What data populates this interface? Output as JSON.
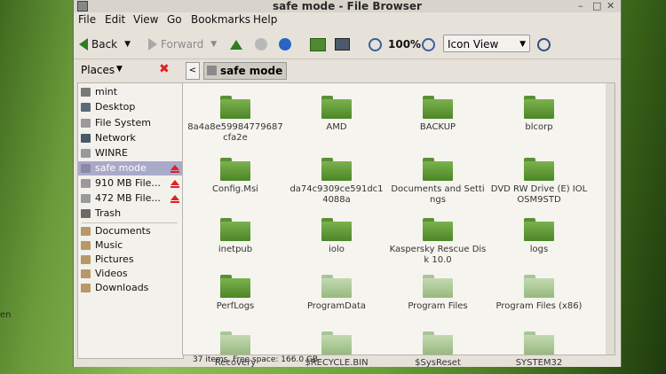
{
  "window": {
    "title": "safe mode - File Browser",
    "controls": [
      "–",
      "□",
      "✕"
    ]
  },
  "menu": [
    "File",
    "Edit",
    "View",
    "Go",
    "Bookmarks",
    "Help"
  ],
  "toolbar": {
    "back": "Back",
    "forward": "Forward",
    "zoom": "100%",
    "view_mode": "Icon View"
  },
  "places": {
    "label": "Places"
  },
  "path": {
    "current": "safe mode"
  },
  "sidebar": {
    "devices": [
      {
        "label": "mint",
        "icon": "drive-icon",
        "selected": false,
        "eject": false
      },
      {
        "label": "Desktop",
        "icon": "desktop-icon",
        "selected": false,
        "eject": false
      },
      {
        "label": "File System",
        "icon": "filesystem-icon",
        "selected": false,
        "eject": false
      },
      {
        "label": "Network",
        "icon": "network-icon",
        "selected": false,
        "eject": false
      },
      {
        "label": "WINRE",
        "icon": "drive-icon",
        "selected": false,
        "eject": false
      },
      {
        "label": "safe mode",
        "icon": "drive-icon",
        "selected": true,
        "eject": true
      },
      {
        "label": "910 MB File...",
        "icon": "drive-icon",
        "selected": false,
        "eject": true
      },
      {
        "label": "472 MB File...",
        "icon": "drive-icon",
        "selected": false,
        "eject": true
      },
      {
        "label": "Trash",
        "icon": "trash-icon",
        "selected": false,
        "eject": false
      }
    ],
    "bookmarks": [
      {
        "label": "Documents",
        "icon": "folder-icon"
      },
      {
        "label": "Music",
        "icon": "folder-icon"
      },
      {
        "label": "Pictures",
        "icon": "folder-icon"
      },
      {
        "label": "Videos",
        "icon": "folder-icon"
      },
      {
        "label": "Downloads",
        "icon": "folder-icon"
      }
    ]
  },
  "files": [
    {
      "name": "8a4a8e59984779687cfa2e",
      "style": "normal"
    },
    {
      "name": "AMD",
      "style": "normal"
    },
    {
      "name": "BACKUP",
      "style": "normal"
    },
    {
      "name": "blcorp",
      "style": "normal"
    },
    {
      "name": "Config.Msi",
      "style": "normal"
    },
    {
      "name": "da74c9309ce591dc14088a",
      "style": "normal"
    },
    {
      "name": "Documents and Settings",
      "style": "link"
    },
    {
      "name": "DVD RW Drive (E) IOLOSM9STD",
      "style": "normal"
    },
    {
      "name": "inetpub",
      "style": "normal"
    },
    {
      "name": "iolo",
      "style": "normal"
    },
    {
      "name": "Kaspersky Rescue Disk 10.0",
      "style": "normal"
    },
    {
      "name": "logs",
      "style": "normal"
    },
    {
      "name": "PerfLogs",
      "style": "normal"
    },
    {
      "name": "ProgramData",
      "style": "pale"
    },
    {
      "name": "Program Files",
      "style": "pale"
    },
    {
      "name": "Program Files (x86)",
      "style": "pale"
    },
    {
      "name": "Recovery",
      "style": "pale"
    },
    {
      "name": "$RECYCLE.BIN",
      "style": "pale"
    },
    {
      "name": "$SysReset",
      "style": "pale"
    },
    {
      "name": "SYSTEM32",
      "style": "pale"
    }
  ],
  "status": {
    "text": "37 items, Free space: 166.0 GB"
  },
  "desktop": {
    "fragment": "en"
  }
}
